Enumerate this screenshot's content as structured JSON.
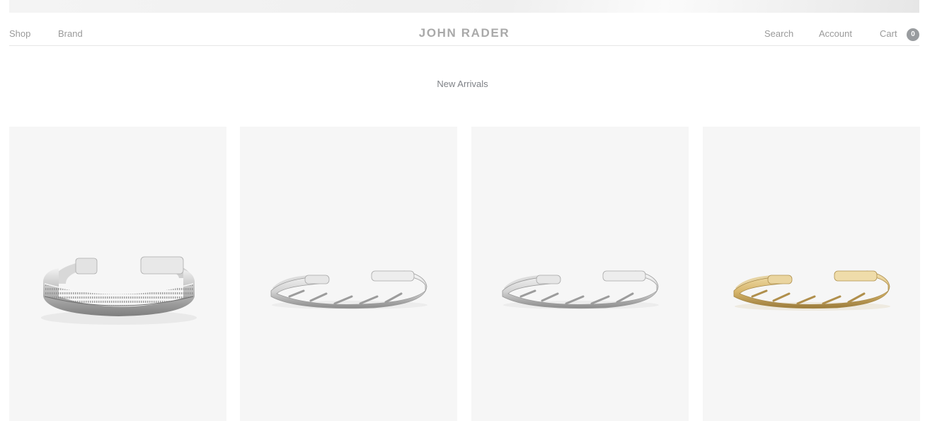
{
  "nav": {
    "left": [
      "Shop",
      "Brand"
    ],
    "brand": "JOHN RADER",
    "right": [
      "Search",
      "Account",
      "Cart"
    ],
    "cart_count": "0"
  },
  "section": {
    "title": "New Arrivals"
  },
  "products": [
    {
      "name": "textured-silver-cuff",
      "metal": "silver"
    },
    {
      "name": "twisted-silver-cuff",
      "metal": "silver"
    },
    {
      "name": "twisted-silver-cuff",
      "metal": "silver"
    },
    {
      "name": "twisted-gold-cuff",
      "metal": "gold"
    }
  ],
  "colors": {
    "nav_text": "#9a9a9a",
    "logo": "#a9a9a9",
    "card_bg": "#f6f6f6",
    "badge_bg": "#999c9f"
  }
}
